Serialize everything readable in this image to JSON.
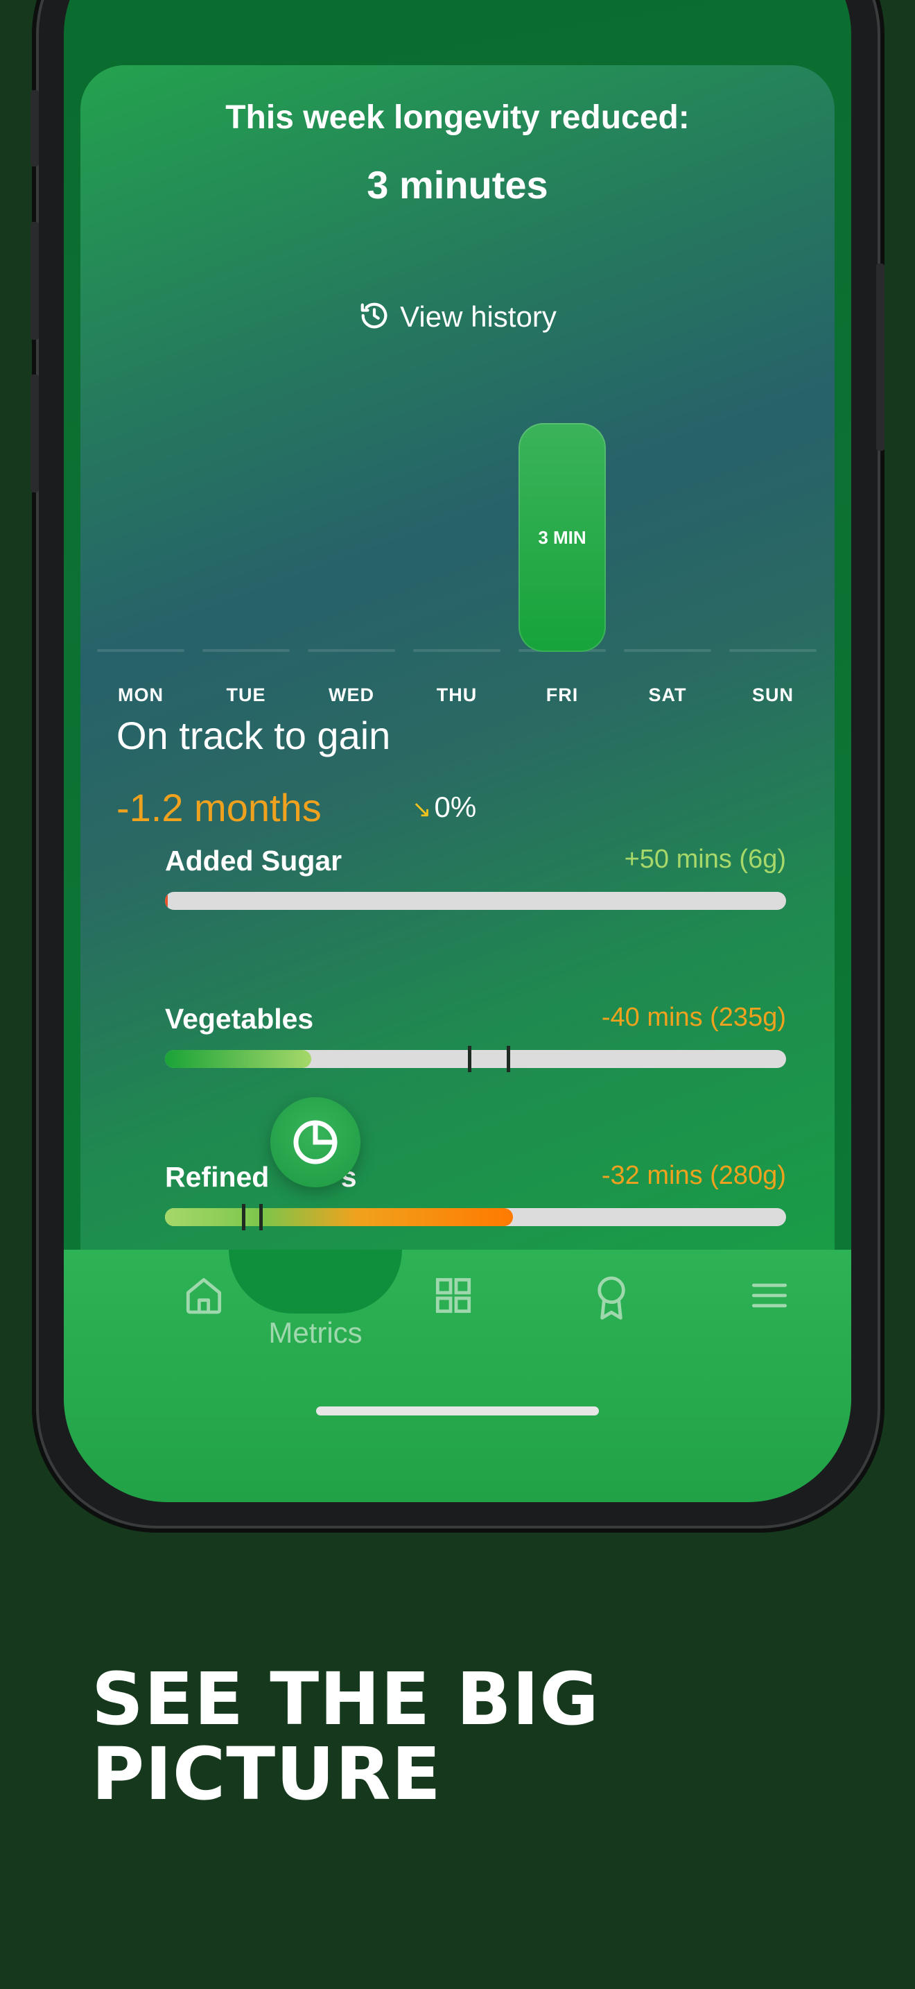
{
  "card": {
    "title": "This week longevity reduced:",
    "amount": "3 minutes",
    "history_label": "View history"
  },
  "chart_data": {
    "type": "bar",
    "categories": [
      "MON",
      "TUE",
      "WED",
      "THU",
      "FRI",
      "SAT",
      "SUN"
    ],
    "values": [
      0,
      0,
      0,
      0,
      3,
      0,
      0
    ],
    "unit": "MIN",
    "bar_labels": [
      "",
      "",
      "",
      "",
      "3 MIN",
      "",
      ""
    ]
  },
  "projection": {
    "title": "On track to gain",
    "value": "-1.2 months",
    "trend_arrow": "↘",
    "trend_pct": "0%"
  },
  "metrics": [
    {
      "name": "Added Sugar",
      "value": "+50 mins (6g)",
      "value_color": "#a8d86a",
      "fill": 0.005,
      "fill_color": "#e8522a"
    },
    {
      "name": "Vegetables",
      "value": "-40 mins (235g)",
      "value_color": "#f0a21e",
      "fill": 0.235,
      "fill_color": "green-gradient"
    },
    {
      "name": "Refined ",
      "name_tail": "s",
      "value": "-32 mins (280g)",
      "value_color": "#f0a21e",
      "fill": 0.56,
      "fill_color": "green-orange-gradient"
    }
  ],
  "nav": {
    "items": [
      {
        "icon": "home-icon"
      },
      {
        "icon": "metrics-icon",
        "label": "Metrics",
        "active": true
      },
      {
        "icon": "grid-icon"
      },
      {
        "icon": "award-icon"
      },
      {
        "icon": "menu-icon"
      }
    ],
    "active_label": "Metrics"
  },
  "headline": {
    "line1": "SEE THE BIG",
    "line2": "PICTURE"
  }
}
